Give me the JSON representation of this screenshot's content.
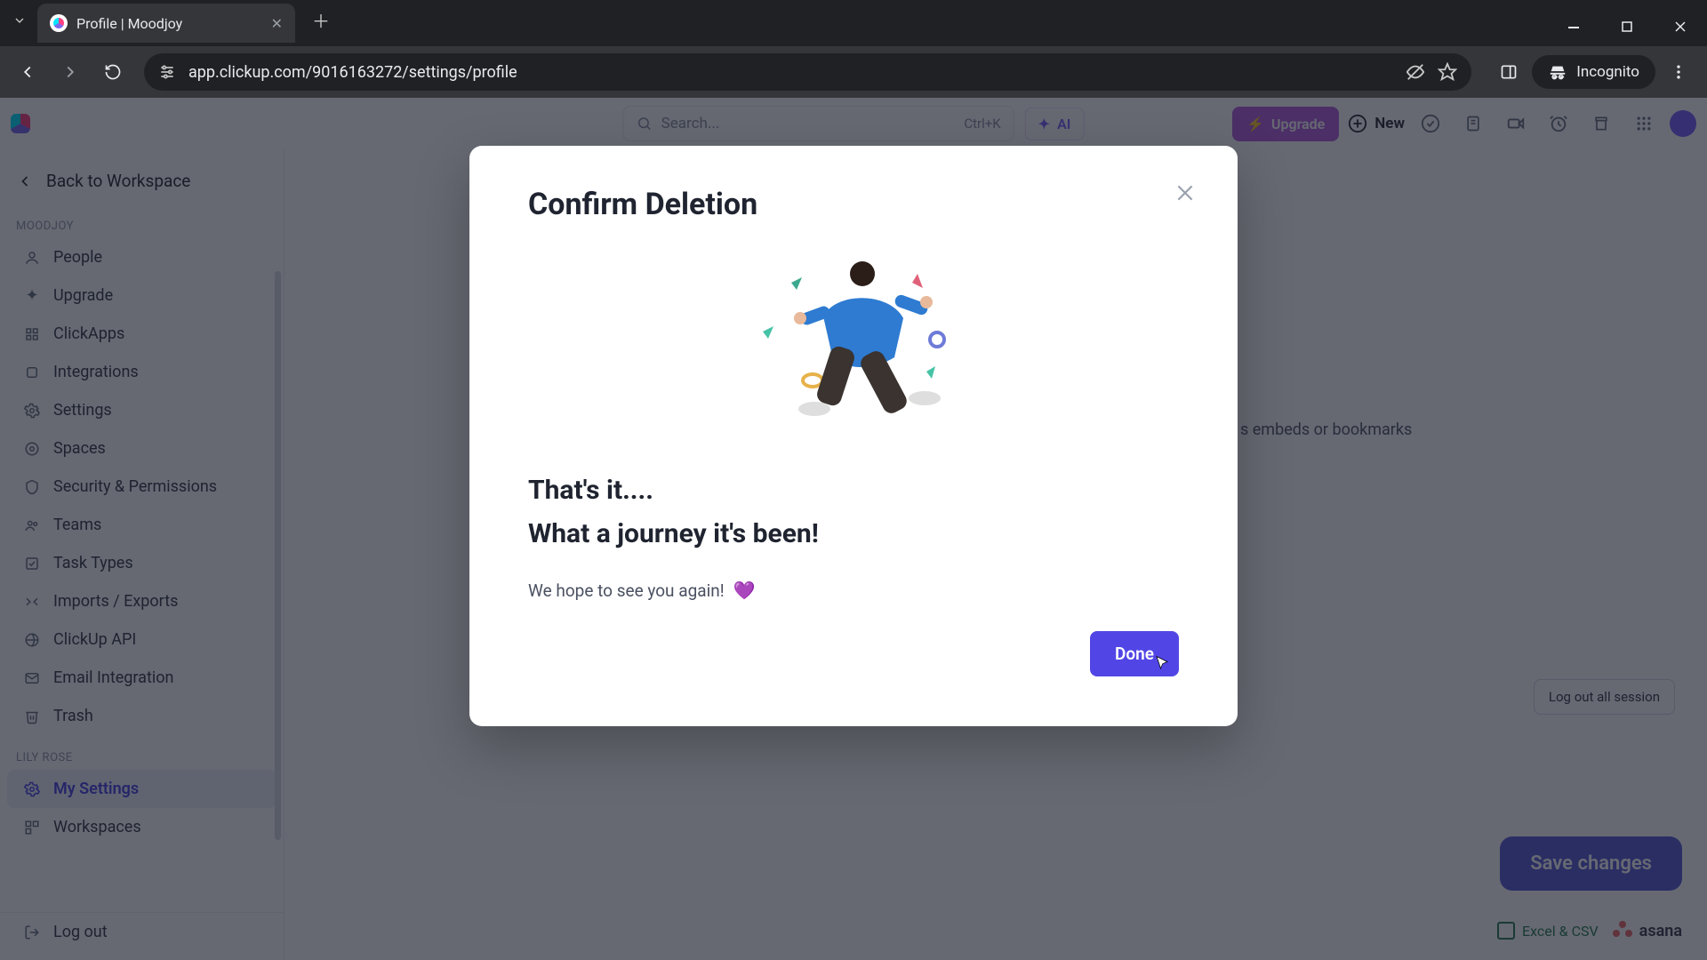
{
  "browser": {
    "tab_title": "Profile | Moodjoy",
    "url": "app.clickup.com/9016163272/settings/profile",
    "incognito_label": "Incognito"
  },
  "appbar": {
    "search_placeholder": "Search...",
    "search_kbd": "Ctrl+K",
    "ai_label": "AI",
    "upgrade_label": "Upgrade",
    "new_label": "New"
  },
  "sidebar": {
    "back_label": "Back to Workspace",
    "section_workspace": "MOODJOY",
    "section_user": "LILY ROSE",
    "workspace_items": [
      {
        "label": "People"
      },
      {
        "label": "Upgrade"
      },
      {
        "label": "ClickApps"
      },
      {
        "label": "Integrations"
      },
      {
        "label": "Settings"
      },
      {
        "label": "Spaces"
      },
      {
        "label": "Security & Permissions"
      },
      {
        "label": "Teams"
      },
      {
        "label": "Task Types"
      },
      {
        "label": "Imports / Exports"
      },
      {
        "label": "ClickUp API"
      },
      {
        "label": "Email Integration"
      },
      {
        "label": "Trash"
      }
    ],
    "user_items": [
      {
        "label": "My Settings",
        "active": true
      },
      {
        "label": "Workspaces"
      }
    ],
    "logout_label": "Log out"
  },
  "main": {
    "embeds_hint_fragment": "s embeds or bookmarks",
    "logout_all_label": "Log out all session",
    "excel_chip": "Excel & CSV",
    "asana_chip": "asana",
    "save_label": "Save changes"
  },
  "modal": {
    "title": "Confirm Deletion",
    "line1": "That's it....",
    "line2": "What a journey it's been!",
    "body": "We hope to see you again!",
    "done_label": "Done"
  }
}
